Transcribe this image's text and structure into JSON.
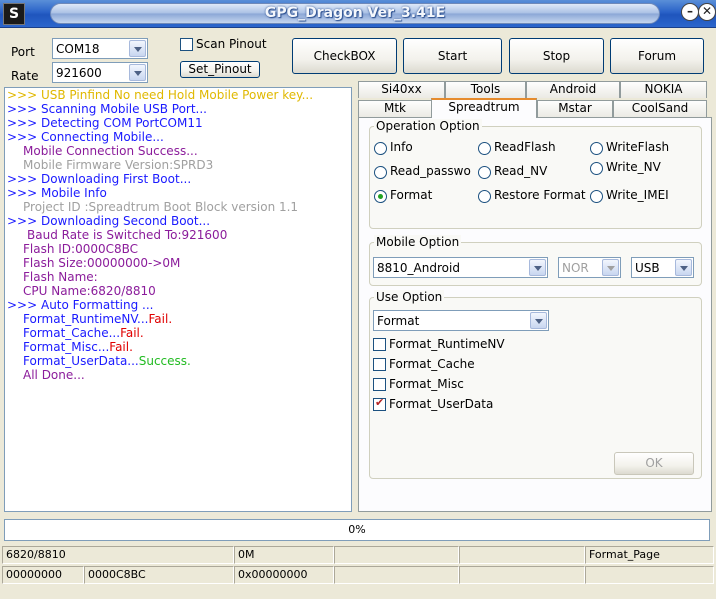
{
  "window": {
    "title": "GPG_Dragon  Ver_3.41E",
    "app_icon": "S"
  },
  "connection": {
    "port_label": "Port",
    "port_value": "COM18",
    "rate_label": "Rate",
    "rate_value": "921600",
    "scan_pinout_label": "Scan Pinout",
    "scan_pinout_checked": false,
    "set_pinout_label": "Set_Pinout"
  },
  "toolbar": {
    "checkbox_label": "CheckBOX",
    "start_label": "Start",
    "stop_label": "Stop",
    "forum_label": "Forum"
  },
  "log": [
    {
      "text": ">>> USB Pinfind No need Hold Mobile Power key...",
      "color": "#e0b800"
    },
    {
      "text": ">>> Scanning Mobile USB Port...",
      "color": "#1a1aff"
    },
    {
      "text": ">>> Detecting COM PortCOM11",
      "color": "#1a1aff"
    },
    {
      "text": ">>> Connecting Mobile...",
      "color": "#1a1aff"
    },
    {
      "text": "Mobile Connection Success...",
      "color": "#8b1c9b"
    },
    {
      "text": "Mobile Firmware Version:SPRD3",
      "color": "#a0a0a0"
    },
    {
      "text": ">>> Downloading First Boot...",
      "color": "#1a1aff"
    },
    {
      "text": ">>> Mobile Info",
      "color": "#1a1aff"
    },
    {
      "text": "Project ID :Spreadtrum Boot Block version 1.1",
      "color": "#a0a0a0"
    },
    {
      "text": ">>> Downloading Second Boot...",
      "color": "#1a1aff"
    },
    {
      "text": "Baud Rate is Switched To:921600",
      "color": "#8b1c9b"
    },
    {
      "text": "Flash ID:0000C8BC",
      "color": "#8b1c9b"
    },
    {
      "text": "Flash Size:00000000->0M",
      "color": "#8b1c9b"
    },
    {
      "text": "Flash Name:",
      "color": "#8b1c9b"
    },
    {
      "text": "CPU Name:6820/8810",
      "color": "#8b1c9b"
    },
    {
      "text": ">>> Auto Formatting ...",
      "color": "#1a1aff"
    },
    {
      "text": "Format_RuntimeNV...",
      "color": "#1a1aff",
      "status": "Fail.",
      "status_color": "#e00000"
    },
    {
      "text": "Format_Cache...",
      "color": "#1a1aff",
      "status": "Fail.",
      "status_color": "#e00000"
    },
    {
      "text": "Format_Misc...",
      "color": "#1a1aff",
      "status": "Fail.",
      "status_color": "#e00000"
    },
    {
      "text": "Format_UserData...",
      "color": "#1a1aff",
      "status": "Success.",
      "status_color": "#22bb22"
    },
    {
      "text": "All Done...",
      "color": "#8b1c9b"
    }
  ],
  "tabs_row1": [
    "Si40xx",
    "Tools",
    "Android",
    "NOKIA"
  ],
  "tabs_row2": [
    "Mtk",
    "Spreadtrum",
    "Mstar",
    "CoolSand"
  ],
  "active_tab": "Spreadtrum",
  "operation_option": {
    "title": "Operation Option",
    "options": [
      "Info",
      "ReadFlash",
      "WriteFlash",
      "Read_passwo",
      "Read_NV",
      "Write_NV",
      "Format",
      "Restore Format",
      "Write_IMEI"
    ],
    "selected": "Format"
  },
  "mobile_option": {
    "title": "Mobile Option",
    "model": "8810_Android",
    "flash_type": "NOR",
    "connection": "USB"
  },
  "use_option": {
    "title": "Use Option",
    "mode": "Format",
    "checks": [
      {
        "label": "Format_RuntimeNV",
        "checked": false
      },
      {
        "label": "Format_Cache",
        "checked": false
      },
      {
        "label": "Format_Misc",
        "checked": false
      },
      {
        "label": "Format_UserData",
        "checked": true
      }
    ],
    "ok_label": "OK"
  },
  "progress": {
    "value": 0,
    "text": "0%"
  },
  "status_row1": [
    "6820/8810",
    "0M",
    "",
    "",
    "Format_Page"
  ],
  "status_row2": [
    "00000000",
    "0000C8BC",
    "0x00000000",
    "",
    "",
    ""
  ],
  "colors": {
    "title_bar": "#2a62c8",
    "accent_tab": "#e68b2c",
    "fail": "#e00000",
    "success": "#22bb22"
  },
  "icons": {
    "minimize": "minimize-icon",
    "close": "close-icon",
    "dropdown": "chevron-down-icon"
  }
}
